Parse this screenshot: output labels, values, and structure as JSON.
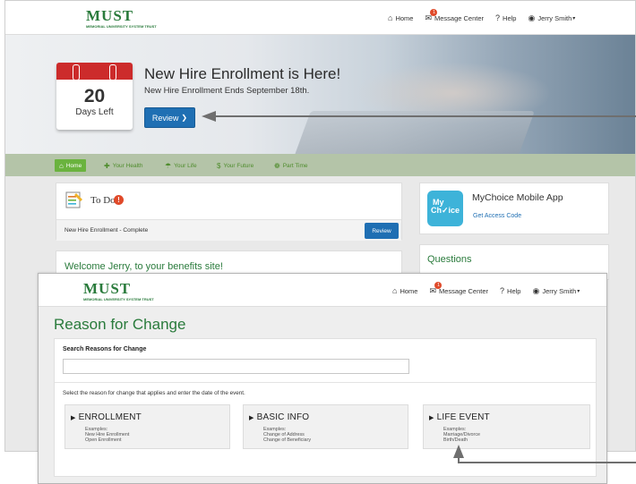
{
  "back": {
    "logo": {
      "text": "MUST",
      "sub": "MEMORIAL UNIVERSITY SYSTEM TRUST"
    },
    "topnav": {
      "home": "Home",
      "messages": "Message Center",
      "message_count": "1",
      "help": "Help",
      "user": "Jerry Smith"
    },
    "hero": {
      "days": "20",
      "days_label": "Days Left",
      "title": "New Hire Enrollment is Here!",
      "subtitle": "New Hire Enrollment Ends September 18th.",
      "review_label": "Review",
      "review_chevron": "❯"
    },
    "green_nav": [
      "Home",
      "Your Health",
      "Your Life",
      "Your Future",
      "Part Time"
    ],
    "todo": {
      "title": "To Do",
      "count": "!",
      "item": "New Hire Enrollment - Complete",
      "item_button": "Review"
    },
    "welcome": "Welcome Jerry, to your benefits site!",
    "app": {
      "icon_line1": "My",
      "icon_line2": "Ch✓ice",
      "title": "MyChoice Mobile App",
      "link": "Get Access Code"
    },
    "questions": "Questions"
  },
  "front": {
    "logo": {
      "text": "MUST",
      "sub": "MEMORIAL UNIVERSITY SYSTEM TRUST"
    },
    "topnav": {
      "home": "Home",
      "messages": "Message Center",
      "message_count": "1",
      "help": "Help",
      "user": "Jerry Smith"
    },
    "title": "Reason for Change",
    "search_label": "Search Reasons for Change",
    "search_value": "",
    "instruction": "Select the reason for change that applies and enter the date of the event.",
    "options": [
      {
        "label": "ENROLLMENT",
        "examples_label": "Examples:",
        "examples": [
          "New Hire Enrollment",
          "Open Enrollment"
        ]
      },
      {
        "label": "BASIC INFO",
        "examples_label": "Examples:",
        "examples": [
          "Change of Address",
          "Change of Beneficiary"
        ]
      },
      {
        "label": "LIFE EVENT",
        "examples_label": "Examples:",
        "examples": [
          "Marriage/Divorce",
          "Birth/Death"
        ]
      }
    ]
  },
  "colors": {
    "brand_green": "#2a7b3c",
    "nav_green": "#6ab33e",
    "button_blue": "#1f6fb3",
    "alert_red": "#e04a2a",
    "calendar_red": "#cc2b2b"
  }
}
